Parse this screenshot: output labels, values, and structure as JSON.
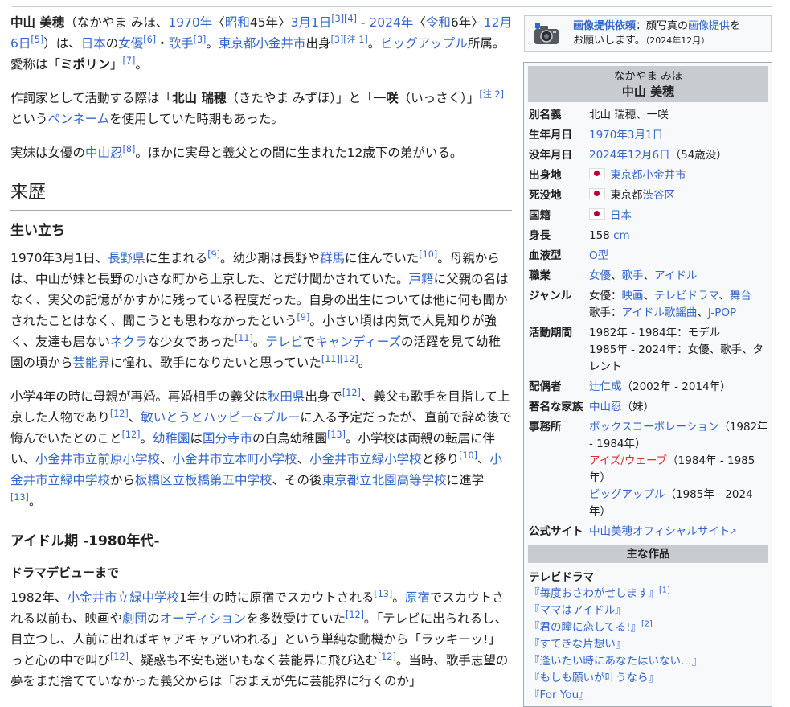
{
  "notice": {
    "link": "画像提供依頼",
    "text1": "：顔写真の",
    "link2": "画像提供",
    "text2": "を",
    "text3": "お願いします。",
    "date": "（2024年12月）"
  },
  "intro": {
    "name": "中山 美穂",
    "reading": "（なかやま みほ、",
    "birth_year": "1970年",
    "era_open": "〈",
    "showa": "昭和",
    "showa_year": "45年",
    "era_close": "〉",
    "birth_day": "3月1日",
    "ref_a": "[3]",
    "ref_b": "[4]",
    "dash": " - ",
    "death_year": "2024年",
    "era_open2": "〈",
    "reiwa": "令和",
    "reiwa_year": "6年",
    "era_close2": "〉",
    "death_day": "12月6日",
    "ref_c": "[5]",
    "t1": "）は、",
    "japan": "日本",
    "t2": "の",
    "actress": "女優",
    "ref_d": "[6]",
    "dot": "・",
    "singer": "歌手",
    "ref_e": "[3]",
    "t3": "。",
    "birthplace": "東京都小金井市",
    "t4": "出身",
    "ref_f": "[3]",
    "ref_g": "[注 1]",
    "t5": "。",
    "agency": "ビッグアップル",
    "t6": "所属。愛称は「",
    "nick": "ミポリン",
    "t7": "」",
    "ref_h": "[7]",
    "t8": "。"
  },
  "pen": {
    "t1": "作詞家として活動する際は「",
    "name1": "北山 瑞穂",
    "t2": "（きたやま みずほ）」と「",
    "name2": "一咲",
    "t3": "（いっさく）」",
    "ref": "[注 2]",
    "t4": "という",
    "penname": "ペンネーム",
    "t5": "を使用していた時期もあった。"
  },
  "sister": {
    "t1": "実妹は女優の",
    "name": "中山忍",
    "ref": "[8]",
    "t2": "。ほかに実母と義父との間に生まれた12歳下の弟がいる。"
  },
  "h2_career": "来歴",
  "h3_early": "生い立ち",
  "p1": {
    "t1": "1970年3月1日、",
    "nagano": "長野県",
    "t2": "に生まれる",
    "r1": "[9]",
    "t3": "。幼少期は長野や",
    "gunma": "群馬",
    "t4": "に住んでいた",
    "r2": "[10]",
    "t5": "。母親からは、中山が妹と長野の小さな町から上京した、とだけ聞かされていた。",
    "koseki": "戸籍",
    "t6": "に父親の名はなく、実父の記憶がかすかに残っている程度だった。自身の出生については他に何も聞かされたことはなく、聞こうとも思わなかったという",
    "r3": "[9]",
    "t7": "。小さい頃は内気で人見知りが強く、友達も居ないネクラな少女であった",
    "nekura": "ネクラ",
    "r4": "[11]",
    "t8": "。",
    "tv": "テレビ",
    "t9": "で",
    "candies": "キャンディーズ",
    "t10": "の活躍を見て幼稚園の頃から",
    "geinokai": "芸能界",
    "t11": "に憧れ、歌手になりたいと思っていた",
    "r5": "[11]",
    "r6": "[12]",
    "t12": "。"
  },
  "p2": {
    "t1": "小学4年の時に母親が再婚。再婚相手の義父は",
    "akita": "秋田県",
    "t2": "出身で",
    "r1": "[12]",
    "t3": "、義父も歌手を目指して上京した人物であり",
    "r2": "[12]",
    "t4": "、",
    "group": "敏いとうとハッピー&ブルー",
    "t5": "に入る予定だったが、直前で辞め後で悔んでいたとのこと",
    "r3": "[12]",
    "t6": "。",
    "kinder": "幼稚園",
    "t7": "は",
    "kokubunji": "国分寺市",
    "t8": "の白鳥幼稚園",
    "r4": "[13]",
    "t9": "。小学校は両親の転居に伴い、",
    "s1": "小金井市立前原小学校",
    "t10": "、",
    "s2": "小金井市立本町小学校",
    "t11": "、",
    "s3": "小金井市立緑小学校",
    "t12": "と移り",
    "r5": "[10]",
    "t13": "、",
    "s4": "小金井市立緑中学校",
    "t14": "から",
    "s5": "板橋区立板橋第五中学校",
    "t15": "、その後",
    "s6": "東京都立北園高等学校",
    "t16": "に進学",
    "r6": "[13]",
    "t17": "。"
  },
  "h3_idol": "アイドル期 -1980年代-",
  "h4_drama": "ドラマデビューまで",
  "p3": {
    "t1": "1982年、",
    "school": "小金井市立緑中学校",
    "t2": "1年生の時に原宿でスカウトされる",
    "r1": "[13]",
    "t3": "。",
    "harajuku": "原宿",
    "t4": "でスカウトされる以前も、映画や",
    "gekidan": "劇団",
    "t5": "の",
    "audition": "オーディション",
    "t6": "を多数受けていた",
    "r2": "[12]",
    "t7": "。「テレビに出られるし、目立つし、人前に出ればキャアキャアいわれる」という単純な動機から「ラッキーッ!」っと心の中で叫び",
    "r3": "[12]",
    "t8": "、疑惑も不安も迷いもなく芸能界に飛び込む",
    "r4": "[12]",
    "t9": "。当時、歌手志望の夢をまだ捨てていなかった義父からは「おまえが先に芸能界に行くのか」"
  },
  "infobox": {
    "kana": "なかやま みほ",
    "name": "中山 美穂",
    "rows": {
      "alias_label": "別名義",
      "alias_value": "北山 瑞穂、一咲",
      "birth_label": "生年月日",
      "birth_value": "1970年3月1日",
      "death_label": "没年月日",
      "death_value": "2024年12月6日",
      "death_age": "（54歳没）",
      "origin_label": "出身地",
      "origin_value": "東京都小金井市",
      "deathplace_label": "死没地",
      "deathplace_pre": "東京都",
      "deathplace_link": "渋谷区",
      "nation_label": "国籍",
      "nation_value": "日本",
      "height_label": "身長",
      "height_num": "158 ",
      "height_unit": "cm",
      "blood_label": "血液型",
      "blood_value": "O型",
      "job_label": "職業",
      "job_1": "女優",
      "job_2": "歌手",
      "job_3": "アイドル",
      "genre_label": "ジャンル",
      "genre_a": "女優：",
      "genre_a1": "映画",
      "genre_a2": "テレビドラマ",
      "genre_a3": "舞台",
      "genre_b": "歌手：",
      "genre_b1": "アイドル歌謡曲",
      "genre_b2": "J-POP",
      "active_label": "活動期間",
      "active_1": "1982年 - 1984年：モデル",
      "active_2": "1985年 - 2024年：女優、歌手、タレント",
      "spouse_label": "配偶者",
      "spouse_name": "辻仁成",
      "spouse_years": "（2002年 - 2014年）",
      "family_label": "著名な家族",
      "family_name": "中山忍",
      "family_rel": "（妹）",
      "agency_label": "事務所",
      "agency_1": "ボックスコーポレーション",
      "agency_1y": "（1982年 - 1984年）",
      "agency_2": "アイズ/ウェーブ",
      "agency_2y": "（1984年 - 1985年）",
      "agency_3": "ビッグアップル",
      "agency_3y": "（1985年 - 2024年）",
      "site_label": "公式サイト",
      "site_value": "中山美穂オフィシャルサイト"
    },
    "works_header": "主な作品",
    "works_category": "テレビドラマ",
    "works": [
      {
        "title": "『毎度おさわがせします』",
        "ref": "[1]"
      },
      {
        "title": "『ママはアイドル』",
        "ref": ""
      },
      {
        "title": "『君の瞳に恋してる!』",
        "ref": "[2]"
      },
      {
        "title": "『すてきな片想い』",
        "ref": ""
      },
      {
        "title": "『逢いたい時にあなたはいない…』",
        "ref": ""
      },
      {
        "title": "『もしも願いが叶うなら』",
        "ref": ""
      },
      {
        "title": "『For You』",
        "ref": ""
      }
    ]
  },
  "colors": {
    "link": "#3366cc",
    "redlink": "#d73333",
    "infobox_header": "#c8ccd1",
    "border": "#a2a9b1"
  }
}
